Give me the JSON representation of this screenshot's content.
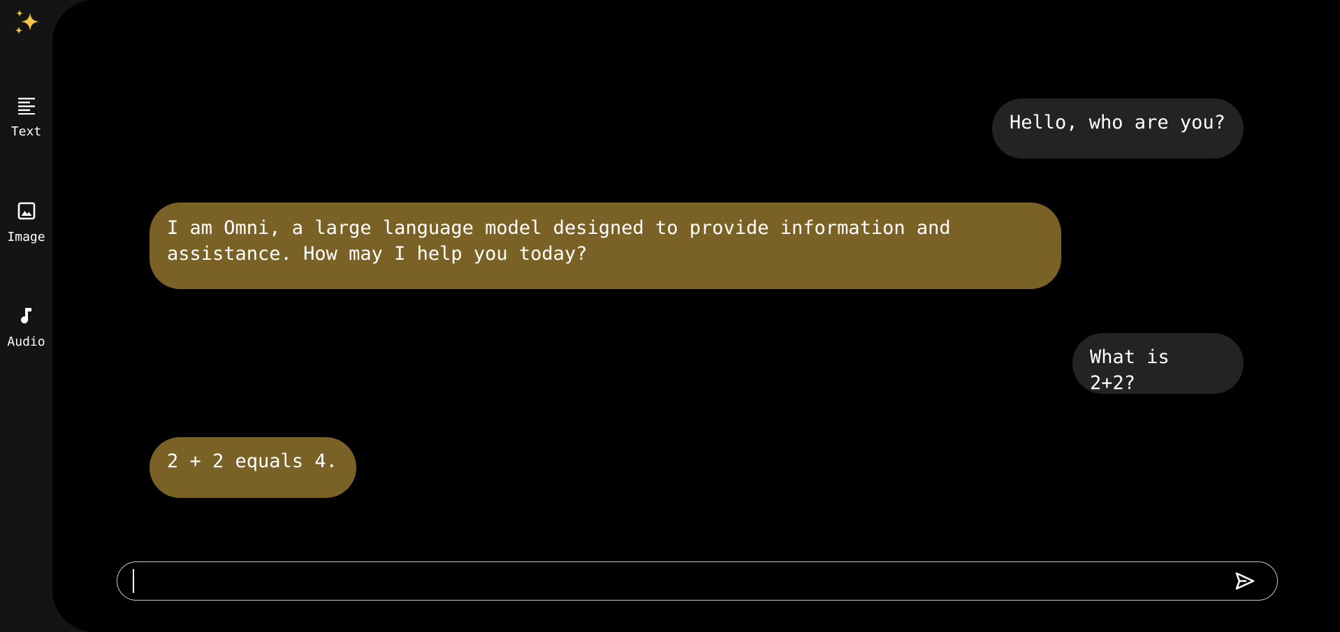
{
  "sidebar": {
    "logo_icon": "sparkles-icon",
    "items": [
      {
        "label": "Text",
        "icon": "text-lines-icon"
      },
      {
        "label": "Image",
        "icon": "image-icon"
      },
      {
        "label": "Audio",
        "icon": "music-note-icon"
      }
    ]
  },
  "chat": {
    "messages": [
      {
        "role": "user",
        "text": "Hello, who are you?"
      },
      {
        "role": "assistant",
        "text": "I am Omni, a large language model designed to provide information and assistance. How may I help you today?"
      },
      {
        "role": "user",
        "text": "What is 2+2?"
      },
      {
        "role": "assistant",
        "text": "2 + 2 equals 4."
      }
    ]
  },
  "composer": {
    "value": "",
    "placeholder": "",
    "send_icon": "send-icon"
  },
  "colors": {
    "app_background": "#141414",
    "chat_background": "#000000",
    "user_bubble": "#232323",
    "assistant_bubble": "#7a6226",
    "logo_star": "#f5c242"
  }
}
